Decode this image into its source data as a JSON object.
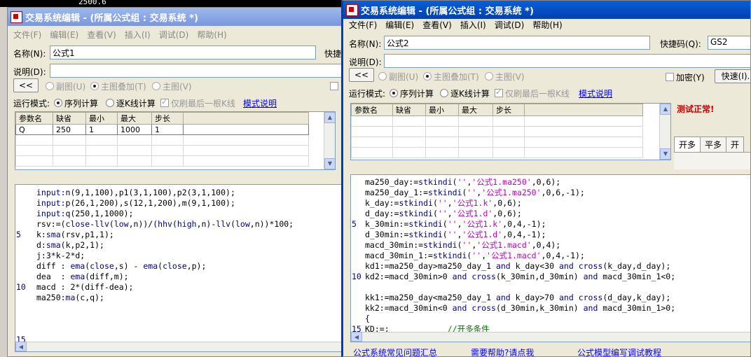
{
  "background_chart": {
    "value_text": "2500.6"
  },
  "left_window": {
    "title": "交易系统编辑 - (所属公式组 : 交易系统 *)",
    "menu": [
      "文件(F)",
      "编辑(E)",
      "查看(V)",
      "插入(I)",
      "调试(D)",
      "帮助(H)"
    ],
    "name_label": "名称(N):",
    "name_value": "公式1",
    "shortcut_label": "快捷",
    "desc_label": "说明(D):",
    "collapse_btn": "<<",
    "radio_subgraph": "副图(U)",
    "radio_overlay": "主图叠加(T)",
    "radio_main": "主图(V)",
    "run_mode_label": "运行模式:",
    "run_seq": "序列计算",
    "run_per_k": "逐K线计算",
    "refresh_last": "仅刷最后一根K线",
    "mode_help": "模式说明",
    "param_headers": [
      "参数名",
      "缺省",
      "最小",
      "最大",
      "步长"
    ],
    "params": [
      [
        "Q",
        "250",
        "1",
        "1000",
        "1"
      ]
    ],
    "code_lines": [
      [
        {
          "t": "input:",
          "c": "kw"
        },
        {
          "t": "n(9,1,100),p1(3,1,100),p2(3,1,100);"
        }
      ],
      [
        {
          "t": "input:",
          "c": "kw"
        },
        {
          "t": "p(26,1,200),s(12,1,200),m(9,1,100);"
        }
      ],
      [
        {
          "t": "input:",
          "c": "kw"
        },
        {
          "t": "q(250,1,1000);"
        }
      ],
      [
        {
          "t": "rsv:=("
        },
        {
          "t": "close",
          "c": "kw"
        },
        {
          "t": "-"
        },
        {
          "t": "llv",
          "c": "kw"
        },
        {
          "t": "("
        },
        {
          "t": "low",
          "c": "kw"
        },
        {
          "t": ",n))/("
        },
        {
          "t": "hhv",
          "c": "kw"
        },
        {
          "t": "("
        },
        {
          "t": "high",
          "c": "kw"
        },
        {
          "t": ",n)-"
        },
        {
          "t": "llv",
          "c": "kw"
        },
        {
          "t": "("
        },
        {
          "t": "low",
          "c": "kw"
        },
        {
          "t": ",n))*100;"
        }
      ],
      [
        {
          "t": "k:"
        },
        {
          "t": "sma",
          "c": "kw"
        },
        {
          "t": "(rsv,p1,1);"
        }
      ],
      [
        {
          "t": "d:"
        },
        {
          "t": "sma",
          "c": "kw"
        },
        {
          "t": "(k,p2,1);"
        }
      ],
      [
        {
          "t": "j:3*k-2*d;"
        }
      ],
      [
        {
          "t": "diff : "
        },
        {
          "t": "ema",
          "c": "kw"
        },
        {
          "t": "("
        },
        {
          "t": "close",
          "c": "kw"
        },
        {
          "t": ",s) - "
        },
        {
          "t": "ema",
          "c": "kw"
        },
        {
          "t": "("
        },
        {
          "t": "close",
          "c": "kw"
        },
        {
          "t": ",p);"
        }
      ],
      [
        {
          "t": "dea  : "
        },
        {
          "t": "ema",
          "c": "kw"
        },
        {
          "t": "(diff,m);"
        }
      ],
      [
        {
          "t": "macd : 2*(diff-dea);"
        }
      ],
      [
        {
          "t": "ma250:"
        },
        {
          "t": "ma",
          "c": "kw"
        },
        {
          "t": "(c,q);"
        }
      ]
    ],
    "line_numbers": [
      {
        "n": "5",
        "row": 4
      },
      {
        "n": "10",
        "row": 9
      },
      {
        "n": "15",
        "row": 14
      }
    ]
  },
  "right_window": {
    "title": "交易系统编辑 - (所属公式组 : 交易系统 *)",
    "menu": [
      "文件(F)",
      "编辑(E)",
      "查看(V)",
      "插入(I)",
      "调试(D)",
      "帮助(H)"
    ],
    "name_label": "名称(N):",
    "name_value": "公式2",
    "shortcut_label": "快捷码(Q):",
    "shortcut_value": "GS2",
    "desc_label": "说明(D):",
    "collapse_btn": "<<",
    "radio_subgraph": "副图(U)",
    "radio_overlay": "主图叠加(T)",
    "radio_main": "主图(V)",
    "encrypt_label": "加密(Y)",
    "quick_btn": "快速(I).",
    "run_mode_label": "运行模式:",
    "run_seq": "序列计算",
    "run_per_k": "逐K线计算",
    "refresh_last": "仅刷最后一根K线",
    "mode_help": "模式说明",
    "param_headers": [
      "参数名",
      "缺省",
      "最小",
      "最大",
      "步长"
    ],
    "test_status": "测试正常!",
    "status_color": "#cc0000",
    "tabs": [
      "开多",
      "平多",
      "开"
    ],
    "code_lines": [
      [
        {
          "t": "ma250_day:="
        },
        {
          "t": "stkindi",
          "c": "kw"
        },
        {
          "t": "("
        },
        {
          "t": "''",
          "c": "str"
        },
        {
          "t": ","
        },
        {
          "t": "'公式1.ma250'",
          "c": "str"
        },
        {
          "t": ",0,6);"
        }
      ],
      [
        {
          "t": "ma250_day_1:="
        },
        {
          "t": "stkindi",
          "c": "kw"
        },
        {
          "t": "("
        },
        {
          "t": "''",
          "c": "str"
        },
        {
          "t": ","
        },
        {
          "t": "'公式1.ma250'",
          "c": "str"
        },
        {
          "t": ",0,6,-1);"
        }
      ],
      [
        {
          "t": "k_day:="
        },
        {
          "t": "stkindi",
          "c": "kw"
        },
        {
          "t": "("
        },
        {
          "t": "''",
          "c": "str"
        },
        {
          "t": ","
        },
        {
          "t": "'公式1.k'",
          "c": "str"
        },
        {
          "t": ",0,6);"
        }
      ],
      [
        {
          "t": "d_day:="
        },
        {
          "t": "stkindi",
          "c": "kw"
        },
        {
          "t": "("
        },
        {
          "t": "''",
          "c": "str"
        },
        {
          "t": ","
        },
        {
          "t": "'公式1.d'",
          "c": "str"
        },
        {
          "t": ",0,6);"
        }
      ],
      [
        {
          "t": "k_30min:="
        },
        {
          "t": "stkindi",
          "c": "kw"
        },
        {
          "t": "("
        },
        {
          "t": "''",
          "c": "str"
        },
        {
          "t": ","
        },
        {
          "t": "'公式1.k'",
          "c": "str"
        },
        {
          "t": ",0,4,-1);"
        }
      ],
      [
        {
          "t": "d_30min:="
        },
        {
          "t": "stkindi",
          "c": "kw"
        },
        {
          "t": "("
        },
        {
          "t": "''",
          "c": "str"
        },
        {
          "t": ","
        },
        {
          "t": "'公式1.d'",
          "c": "str"
        },
        {
          "t": ",0,4,-1);"
        }
      ],
      [
        {
          "t": "macd_30min:="
        },
        {
          "t": "stkindi",
          "c": "kw"
        },
        {
          "t": "("
        },
        {
          "t": "''",
          "c": "str"
        },
        {
          "t": ","
        },
        {
          "t": "'公式1.macd'",
          "c": "str"
        },
        {
          "t": ",0,4);"
        }
      ],
      [
        {
          "t": "macd_30min_1:="
        },
        {
          "t": "stkindi",
          "c": "kw"
        },
        {
          "t": "("
        },
        {
          "t": "''",
          "c": "str"
        },
        {
          "t": ","
        },
        {
          "t": "'公式1.macd'",
          "c": "str"
        },
        {
          "t": ",0,4,-1);"
        }
      ],
      [
        {
          "t": "kd1:=ma250_day>ma250_day_1 "
        },
        {
          "t": "and",
          "c": "kw"
        },
        {
          "t": " k_day<30 "
        },
        {
          "t": "and",
          "c": "kw"
        },
        {
          "t": " "
        },
        {
          "t": "cross",
          "c": "kw"
        },
        {
          "t": "(k_day,d_day);"
        }
      ],
      [
        {
          "t": "kd2:=macd_30min>0 "
        },
        {
          "t": "and",
          "c": "kw"
        },
        {
          "t": " "
        },
        {
          "t": "cross",
          "c": "kw"
        },
        {
          "t": "(k_30min,d_30min) "
        },
        {
          "t": "and",
          "c": "kw"
        },
        {
          "t": " macd_30min_1<0;"
        }
      ],
      [],
      [
        {
          "t": "kk1:=ma250_day<ma250_day_1 "
        },
        {
          "t": "and",
          "c": "kw"
        },
        {
          "t": " k_day>70 "
        },
        {
          "t": "and",
          "c": "kw"
        },
        {
          "t": " "
        },
        {
          "t": "cross",
          "c": "kw"
        },
        {
          "t": "(d_day,k_day);"
        }
      ],
      [
        {
          "t": "kk2:=macd_30min<0 "
        },
        {
          "t": "and",
          "c": "kw"
        },
        {
          "t": " "
        },
        {
          "t": "cross",
          "c": "kw"
        },
        {
          "t": "(d_30min,k_30min) "
        },
        {
          "t": "and",
          "c": "kw"
        },
        {
          "t": " macd_30min_1>0;"
        }
      ],
      [
        {
          "t": "{",
          "c": "kw"
        }
      ],
      [
        {
          "t": "KD:=;"
        },
        {
          "t": "            "
        },
        {
          "t": "//开多条件",
          "c": "cmt"
        }
      ]
    ],
    "line_numbers": [
      {
        "n": "5",
        "row": 4
      },
      {
        "n": "10",
        "row": 9
      },
      {
        "n": "15",
        "row": 14
      }
    ],
    "bottom_links": [
      "公式系统常见问题汇总",
      "需要帮助?请点我",
      "公式模型编写调试教程"
    ]
  }
}
